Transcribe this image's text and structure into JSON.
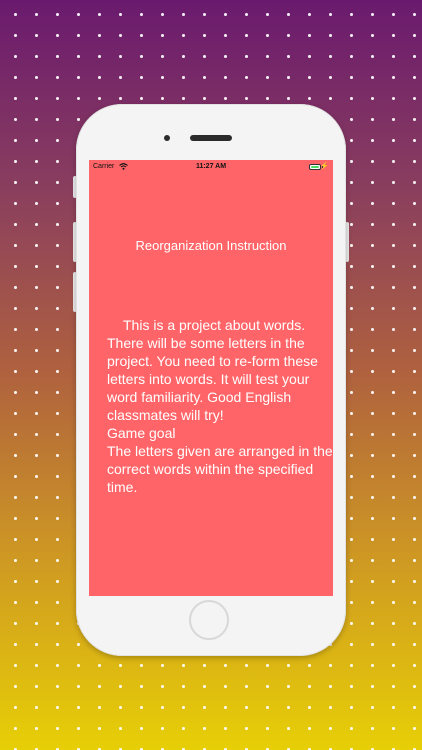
{
  "status_bar": {
    "carrier": "Carrier",
    "time": "11:27 AM",
    "wifi_icon": "wifi-icon",
    "battery_icon": "battery-icon",
    "charging_icon": "bolt-icon",
    "battery_color": "#4cd964"
  },
  "screen": {
    "title": "Reorganization Instruction",
    "intro": "This is a project about words. There will be some letters in the project. You need to re-form these letters into words. It will test your word familiarity. Good English classmates will try!",
    "goal_heading": "Game goal",
    "goal_text": "The letters given are arranged in the correct words within the specified time.",
    "background_color": "#ff6568"
  },
  "colors": {
    "gradient_top": "#6a1a6e",
    "gradient_bottom": "#e7cf06",
    "phone_body": "#f4f4f4"
  }
}
